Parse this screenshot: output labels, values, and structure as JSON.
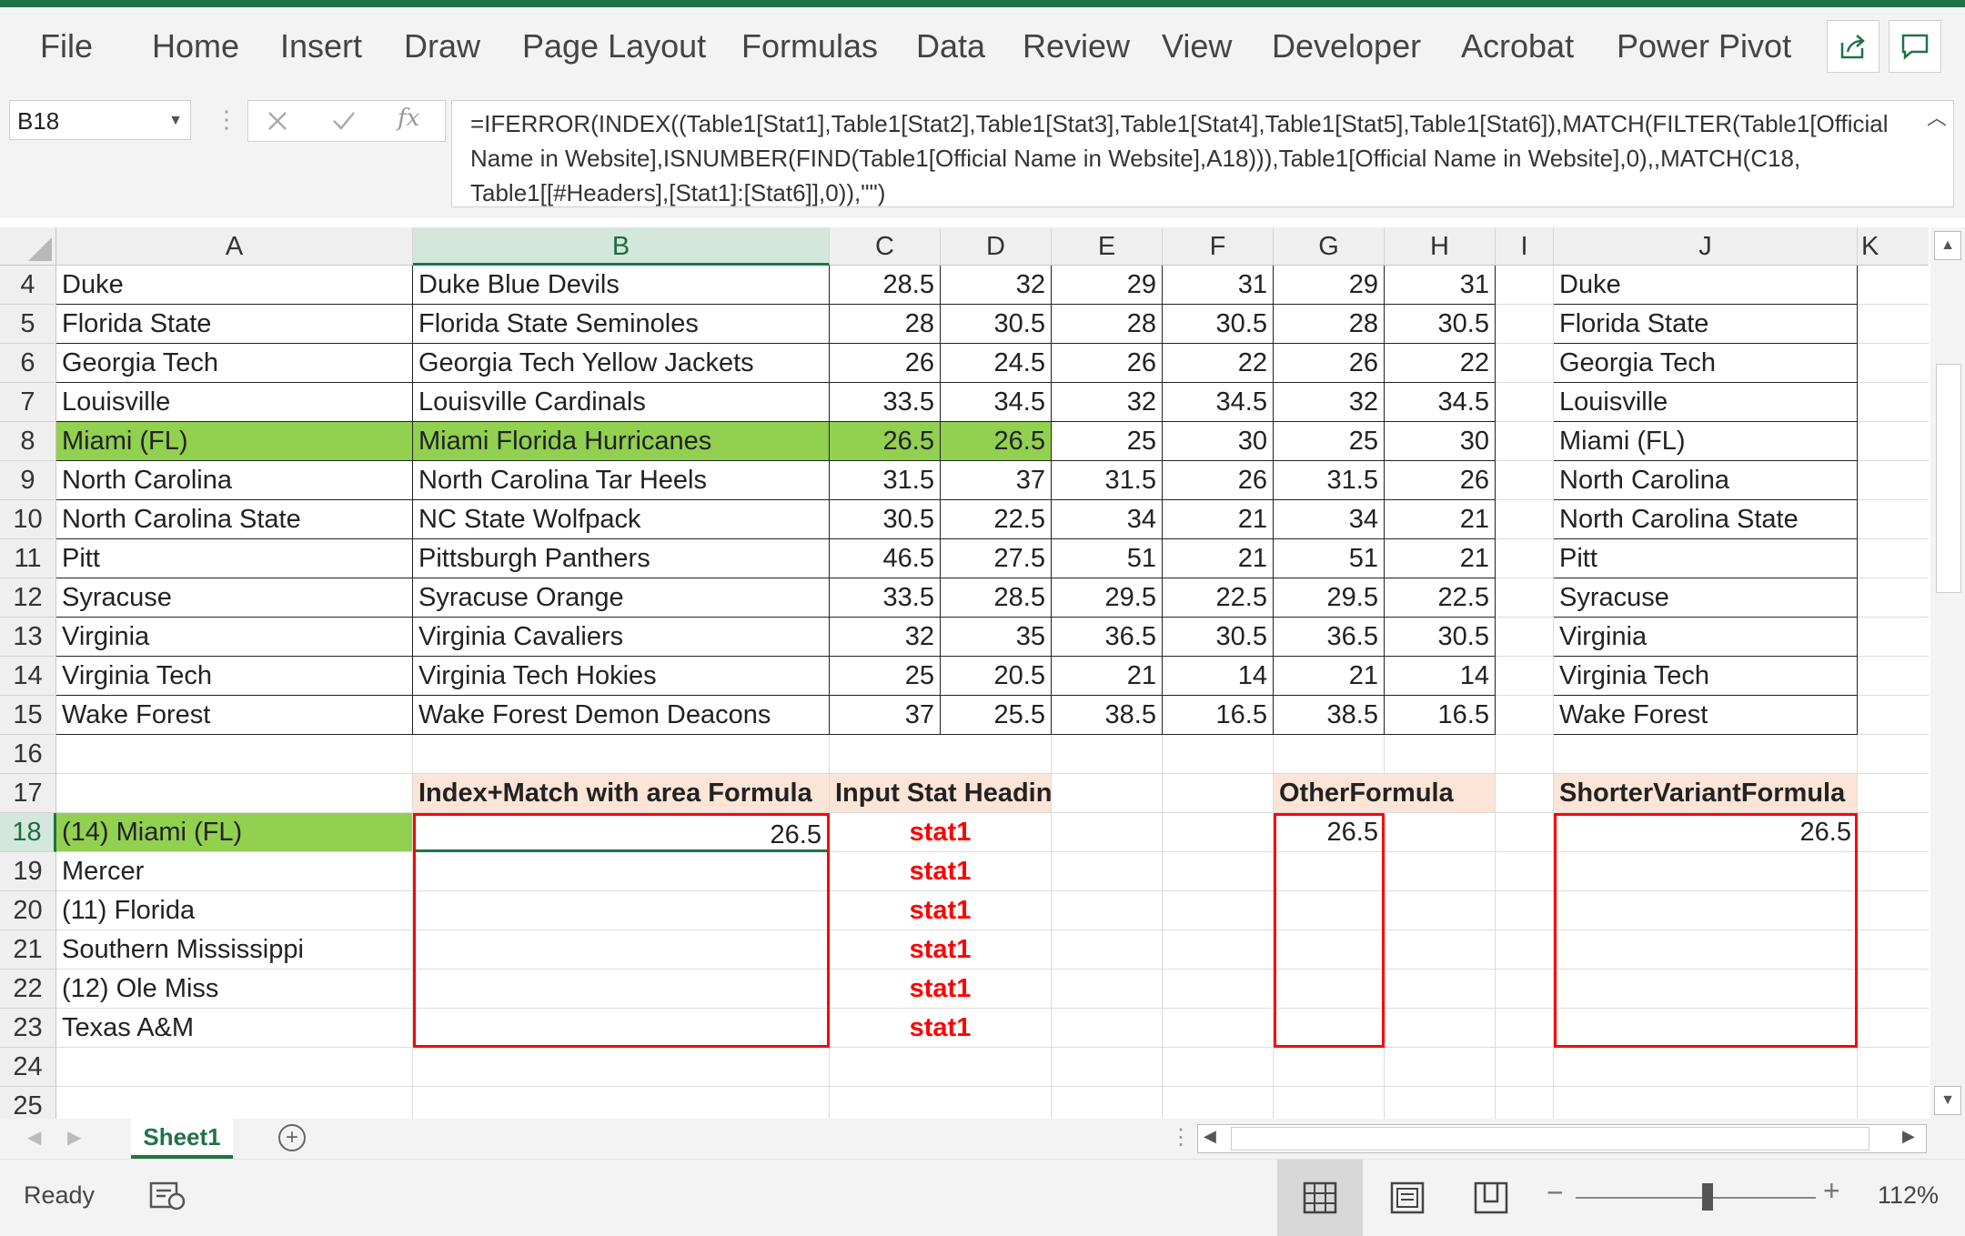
{
  "ribbon": {
    "tabs": [
      "File",
      "Home",
      "Insert",
      "Draw",
      "Page Layout",
      "Formulas",
      "Data",
      "Review",
      "View",
      "Developer",
      "Acrobat",
      "Power Pivot"
    ],
    "share_icon": "share-icon",
    "comments_icon": "comments-icon"
  },
  "formula_bar": {
    "name_box": "B18",
    "cancel_icon": "cancel-icon",
    "enter_icon": "check-icon",
    "fx_label": "fx",
    "formula": "=IFERROR(INDEX((Table1[Stat1],Table1[Stat2],Table1[Stat3],Table1[Stat4],Table1[Stat5],Table1[Stat6]),MATCH(FILTER(Table1[Official Name in Website],ISNUMBER(FIND(Table1[Official Name in Website],A18))),Table1[Official Name in Website],0),,MATCH(C18, Table1[[#Headers],[Stat1]:[Stat6]],0)),\"\")"
  },
  "columns": [
    "A",
    "B",
    "C",
    "D",
    "E",
    "F",
    "G",
    "H",
    "I",
    "J",
    "K"
  ],
  "rows": [
    {
      "n": "4",
      "a": "Duke",
      "b": "Duke Blue Devils",
      "c": "28.5",
      "d": "32",
      "e": "29",
      "f": "31",
      "g": "29",
      "h": "31",
      "j": "Duke"
    },
    {
      "n": "5",
      "a": "Florida State",
      "b": "Florida State Seminoles",
      "c": "28",
      "d": "30.5",
      "e": "28",
      "f": "30.5",
      "g": "28",
      "h": "30.5",
      "j": "Florida State"
    },
    {
      "n": "6",
      "a": "Georgia Tech",
      "b": "Georgia Tech Yellow Jackets",
      "c": "26",
      "d": "24.5",
      "e": "26",
      "f": "22",
      "g": "26",
      "h": "22",
      "j": "Georgia Tech"
    },
    {
      "n": "7",
      "a": "Louisville",
      "b": "Louisville Cardinals",
      "c": "33.5",
      "d": "34.5",
      "e": "32",
      "f": "34.5",
      "g": "32",
      "h": "34.5",
      "j": "Louisville"
    },
    {
      "n": "8",
      "a": "Miami (FL)",
      "b": "Miami Florida Hurricanes",
      "c": "26.5",
      "d": "26.5",
      "e": "25",
      "f": "30",
      "g": "25",
      "h": "30",
      "j": "Miami (FL)"
    },
    {
      "n": "9",
      "a": "North Carolina",
      "b": "North Carolina Tar Heels",
      "c": "31.5",
      "d": "37",
      "e": "31.5",
      "f": "26",
      "g": "31.5",
      "h": "26",
      "j": "North Carolina"
    },
    {
      "n": "10",
      "a": "North Carolina State",
      "b": "NC State Wolfpack",
      "c": "30.5",
      "d": "22.5",
      "e": "34",
      "f": "21",
      "g": "34",
      "h": "21",
      "j": "North Carolina State"
    },
    {
      "n": "11",
      "a": "Pitt",
      "b": "Pittsburgh Panthers",
      "c": "46.5",
      "d": "27.5",
      "e": "51",
      "f": "21",
      "g": "51",
      "h": "21",
      "j": "Pitt"
    },
    {
      "n": "12",
      "a": "Syracuse",
      "b": "Syracuse Orange",
      "c": "33.5",
      "d": "28.5",
      "e": "29.5",
      "f": "22.5",
      "g": "29.5",
      "h": "22.5",
      "j": "Syracuse"
    },
    {
      "n": "13",
      "a": "Virginia",
      "b": "Virginia Cavaliers",
      "c": "32",
      "d": "35",
      "e": "36.5",
      "f": "30.5",
      "g": "36.5",
      "h": "30.5",
      "j": "Virginia"
    },
    {
      "n": "14",
      "a": "Virginia Tech",
      "b": "Virginia Tech Hokies",
      "c": "25",
      "d": "20.5",
      "e": "21",
      "f": "14",
      "g": "21",
      "h": "14",
      "j": "Virginia Tech"
    },
    {
      "n": "15",
      "a": "Wake Forest",
      "b": "Wake Forest Demon Deacons",
      "c": "37",
      "d": "25.5",
      "e": "38.5",
      "f": "16.5",
      "g": "38.5",
      "h": "16.5",
      "j": "Wake Forest"
    }
  ],
  "lower_rows": [
    {
      "n": "16",
      "a": "",
      "b": "",
      "cd": "",
      "g": "",
      "j": ""
    },
    {
      "n": "17",
      "a": "",
      "b": "Index+Match with area Formula",
      "cd": "Input Stat Heading",
      "g": "OtherFormula",
      "j": "ShorterVariantFormula"
    },
    {
      "n": "18",
      "a": "(14) Miami (FL)",
      "b": "26.5",
      "cd": "stat1",
      "g": "26.5",
      "j": "26.5"
    },
    {
      "n": "19",
      "a": "Mercer",
      "b": "",
      "cd": "stat1",
      "g": "",
      "j": ""
    },
    {
      "n": "20",
      "a": "(11) Florida",
      "b": "",
      "cd": "stat1",
      "g": "",
      "j": ""
    },
    {
      "n": "21",
      "a": "Southern Mississippi",
      "b": "",
      "cd": "stat1",
      "g": "",
      "j": ""
    },
    {
      "n": "22",
      "a": "(12) Ole Miss",
      "b": "",
      "cd": "stat1",
      "g": "",
      "j": ""
    },
    {
      "n": "23",
      "a": "Texas A&M",
      "b": "",
      "cd": "stat1",
      "g": "",
      "j": ""
    },
    {
      "n": "24",
      "a": "",
      "b": "",
      "cd": "",
      "g": "",
      "j": ""
    },
    {
      "n": "25",
      "a": "",
      "b": "",
      "cd": "",
      "g": "",
      "j": ""
    }
  ],
  "sheets": {
    "active": "Sheet1",
    "add_icon": "add-sheet-icon"
  },
  "status": {
    "ready": "Ready",
    "zoom": "112%",
    "zoom_minus": "−",
    "zoom_plus": "+",
    "zoom_level_fraction": 0.55
  },
  "colors": {
    "accent": "#217346",
    "highlight_green": "#92d050",
    "header_peach": "#fce4d6",
    "red": "#ff0000"
  }
}
